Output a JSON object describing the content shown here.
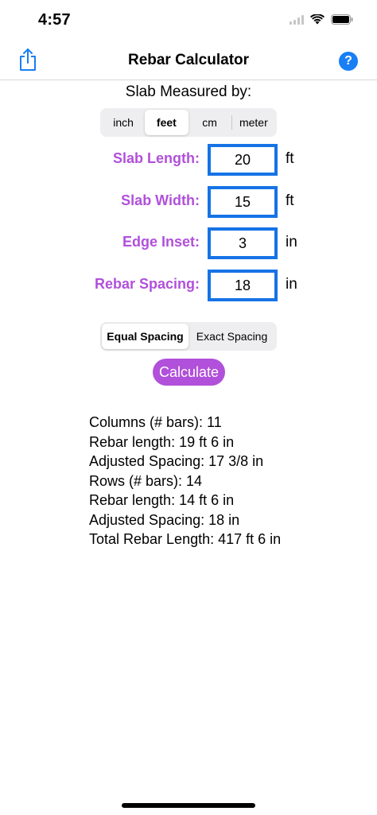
{
  "status_bar": {
    "time": "4:57",
    "icons": [
      "cellular-signal-icon",
      "wifi-icon",
      "battery-icon"
    ]
  },
  "nav": {
    "title": "Rebar Calculator",
    "share_icon": "share-icon",
    "help_label": "?"
  },
  "measured_by": {
    "label": "Slab Measured by:",
    "options": [
      "inch",
      "feet",
      "cm",
      "meter"
    ],
    "selected": "feet"
  },
  "fields": [
    {
      "label": "Slab Length:",
      "value": "20",
      "unit": "ft"
    },
    {
      "label": "Slab Width:",
      "value": "15",
      "unit": "ft"
    },
    {
      "label": "Edge Inset:",
      "value": "3",
      "unit": "in"
    },
    {
      "label": "Rebar Spacing:",
      "value": "18",
      "unit": "in"
    }
  ],
  "spacing_mode": {
    "options": [
      "Equal Spacing",
      "Exact Spacing"
    ],
    "selected": "Equal Spacing"
  },
  "calculate_label": "Calculate",
  "results": [
    "Columns (# bars): 11",
    "Rebar length: 19 ft 6 in",
    "Adjusted Spacing: 17 3/8 in",
    "Rows (# bars): 14",
    "Rebar length: 14 ft 6 in",
    "Adjusted Spacing: 18 in",
    "Total Rebar Length: 417 ft 6 in"
  ],
  "colors": {
    "accent_purple": "#b150da",
    "input_border_blue": "#1673e6",
    "help_blue": "#1a7ef5",
    "share_blue": "#1a7ef5"
  }
}
